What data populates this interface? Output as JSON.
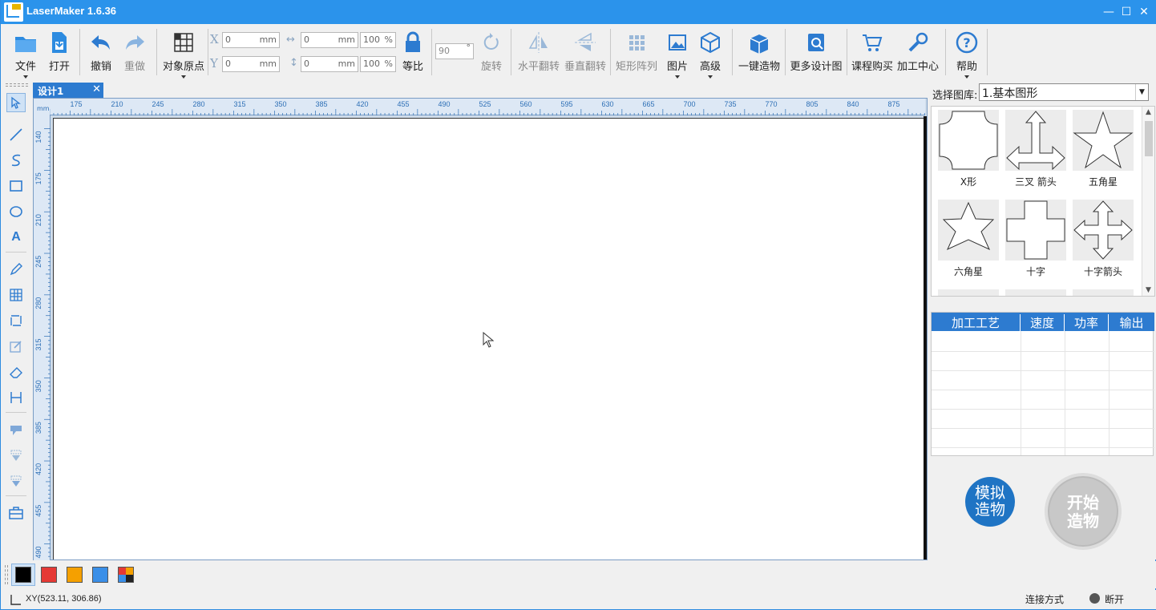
{
  "app": {
    "title": "LaserMaker 1.6.36"
  },
  "window": {
    "minimize": "—",
    "maximize": "☐",
    "close": "✕"
  },
  "toolbar": {
    "file": "文件",
    "open": "打开",
    "undo": "撤销",
    "redo": "重做",
    "origin": "对象原点",
    "x_label": "X",
    "y_label": "Y",
    "x_value": "0",
    "y_value": "0",
    "w_value": "0",
    "h_value": "0",
    "unit": "mm",
    "scale_w": "100",
    "scale_h": "100",
    "percent": "%",
    "lock": "等比",
    "rotate_value": "90",
    "degree": "°",
    "rotate": "旋转",
    "hflip": "水平翻转",
    "vflip": "垂直翻转",
    "array": "矩形阵列",
    "image": "图片",
    "advanced": "高级",
    "oneclick": "一键造物",
    "more": "更多设计图",
    "course": "课程购买",
    "center": "加工中心",
    "help": "帮助"
  },
  "doc": {
    "tab": "设计1",
    "close": "✕"
  },
  "ruler": {
    "unit": "mm",
    "h": [
      "175",
      "210",
      "245",
      "280",
      "315",
      "350",
      "385",
      "420",
      "455",
      "490",
      "525",
      "560",
      "595",
      "630",
      "665",
      "700",
      "735",
      "770",
      "805",
      "840",
      "875"
    ],
    "v": [
      "140",
      "175",
      "210",
      "245",
      "280",
      "315",
      "350",
      "385",
      "420",
      "455",
      "490"
    ]
  },
  "library": {
    "label": "选择图库:",
    "selected": "1.基本图形",
    "shapes": [
      {
        "name": "X形",
        "icon": "x-shape-icon"
      },
      {
        "name": "三叉 箭头",
        "icon": "trident-arrow-icon"
      },
      {
        "name": "五角星",
        "icon": "five-star-icon"
      },
      {
        "name": "六角星",
        "icon": "six-star-icon"
      },
      {
        "name": "十字",
        "icon": "cross-icon"
      },
      {
        "name": "十字箭头",
        "icon": "cross-arrow-icon"
      }
    ]
  },
  "process": {
    "headers": [
      "加工工艺",
      "速度",
      "功率",
      "输出"
    ]
  },
  "actions": {
    "simulate": "模拟造物",
    "start": "开始造物"
  },
  "colors": [
    "#000000",
    "#e53935",
    "#f5a000",
    "#3a8fe8",
    "multi"
  ],
  "status": {
    "coords": "XY(523.11, 306.86)",
    "connection": "连接方式",
    "state": "断开"
  }
}
